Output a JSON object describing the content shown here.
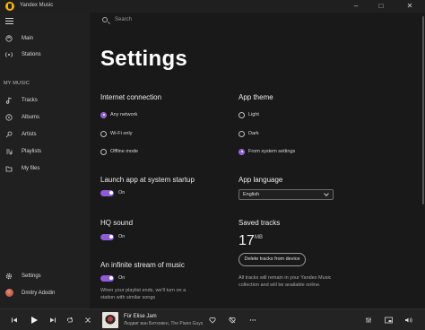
{
  "titlebar": {
    "title": "Yandex Music",
    "minimize": "–",
    "maximize": "□",
    "close": "✕"
  },
  "sidebar": {
    "top_items": [
      {
        "label": "Main",
        "icon": "main-icon"
      },
      {
        "label": "Stations",
        "icon": "stations-icon"
      }
    ],
    "section_label": "MY MUSIC",
    "items": [
      {
        "label": "Tracks",
        "icon": "tracks-icon"
      },
      {
        "label": "Albums",
        "icon": "albums-icon"
      },
      {
        "label": "Artists",
        "icon": "artists-icon"
      },
      {
        "label": "Playlists",
        "icon": "playlists-icon"
      },
      {
        "label": "My files",
        "icon": "files-icon"
      }
    ],
    "settings_label": "Settings",
    "user_name": "Dmitry Adodin"
  },
  "search": {
    "placeholder": "Search"
  },
  "page_title": "Settings",
  "internet": {
    "heading": "Internet connection",
    "options": [
      "Any network",
      "Wi-Fi only",
      "Offline mode"
    ],
    "selected": "Any network"
  },
  "theme": {
    "heading": "App theme",
    "options": [
      "Light",
      "Dark",
      "From system settings"
    ],
    "selected": "From system settings"
  },
  "startup": {
    "heading": "Launch app at system startup",
    "state": "On"
  },
  "language": {
    "heading": "App language",
    "value": "English"
  },
  "hq": {
    "heading": "HQ sound",
    "state": "On"
  },
  "saved": {
    "heading": "Saved tracks",
    "size": "17",
    "unit": "MB",
    "button": "Delete tracks from device",
    "note_line1": "All tracks will remain in your Yandex Music",
    "note_line2": "collection and will be available online."
  },
  "stream": {
    "heading": "An infinite stream of music",
    "state": "On",
    "note_line1": "When your playlist ends, we'll turn on a",
    "note_line2": "station with similar songs"
  },
  "player": {
    "track_title": "Für Elise Jam",
    "track_artist": "Людвиг ван Бетховен, The Piano Guys"
  },
  "colors": {
    "accent": "#8e5cd6",
    "background": "#191919",
    "sidebar": "#202020"
  }
}
